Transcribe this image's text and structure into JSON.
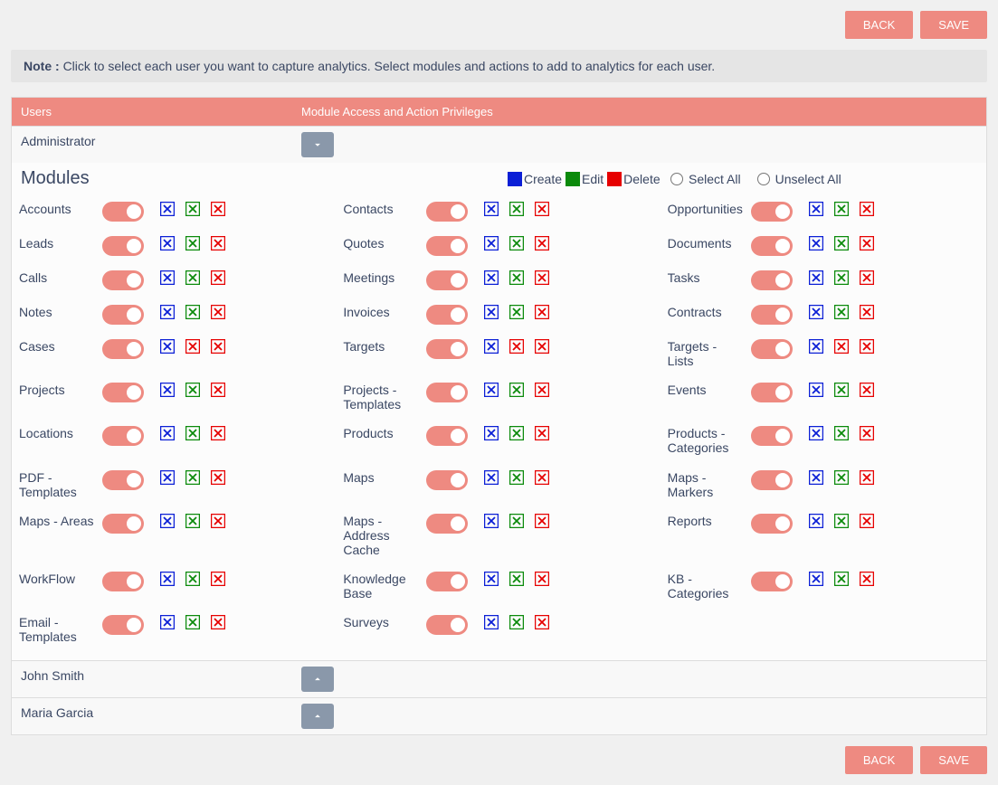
{
  "buttons": {
    "back": "BACK",
    "save": "SAVE"
  },
  "note": {
    "prefix": "Note : ",
    "text": "Click to select each user you want to capture analytics. Select modules and actions to add to analytics for each user."
  },
  "headers": {
    "users": "Users",
    "privileges": "Module Access and Action Privileges"
  },
  "section_title": "Modules",
  "legend": {
    "create": "Create",
    "edit": "Edit",
    "delete": "Delete"
  },
  "select_controls": {
    "select_all": "Select All",
    "unselect_all": "Unselect All"
  },
  "colors": {
    "create": "#0b1fd6",
    "edit": "#0b8a0b",
    "delete": "#e60000",
    "accent": "#ee8a81"
  },
  "users": [
    {
      "name": "Administrator",
      "expanded": true
    },
    {
      "name": "John Smith",
      "expanded": false
    },
    {
      "name": "Maria Garcia",
      "expanded": false
    }
  ],
  "modules": [
    {
      "label": "Accounts",
      "edit": "green"
    },
    {
      "label": "Contacts",
      "edit": "green"
    },
    {
      "label": "Opportunities",
      "edit": "green"
    },
    {
      "label": "Leads",
      "edit": "green"
    },
    {
      "label": "Quotes",
      "edit": "green"
    },
    {
      "label": "Documents",
      "edit": "green"
    },
    {
      "label": "Calls",
      "edit": "green"
    },
    {
      "label": "Meetings",
      "edit": "green"
    },
    {
      "label": "Tasks",
      "edit": "green"
    },
    {
      "label": "Notes",
      "edit": "green"
    },
    {
      "label": "Invoices",
      "edit": "green"
    },
    {
      "label": "Contracts",
      "edit": "green"
    },
    {
      "label": "Cases",
      "edit": "red"
    },
    {
      "label": "Targets",
      "edit": "red"
    },
    {
      "label": "Targets - Lists",
      "edit": "red"
    },
    {
      "label": "Projects",
      "edit": "green"
    },
    {
      "label": "Projects - Templates",
      "edit": "green"
    },
    {
      "label": "Events",
      "edit": "green"
    },
    {
      "label": "Locations",
      "edit": "green"
    },
    {
      "label": "Products",
      "edit": "green"
    },
    {
      "label": "Products - Categories",
      "edit": "green"
    },
    {
      "label": "PDF - Templates",
      "edit": "green"
    },
    {
      "label": "Maps",
      "edit": "green"
    },
    {
      "label": "Maps - Markers",
      "edit": "green"
    },
    {
      "label": "Maps - Areas",
      "edit": "green"
    },
    {
      "label": "Maps - Address Cache",
      "edit": "green"
    },
    {
      "label": "Reports",
      "edit": "green"
    },
    {
      "label": "WorkFlow",
      "edit": "green"
    },
    {
      "label": "Knowledge Base",
      "edit": "green"
    },
    {
      "label": "KB - Categories",
      "edit": "green"
    },
    {
      "label": "Email - Templates",
      "edit": "green"
    },
    {
      "label": "Surveys",
      "edit": "green"
    }
  ]
}
